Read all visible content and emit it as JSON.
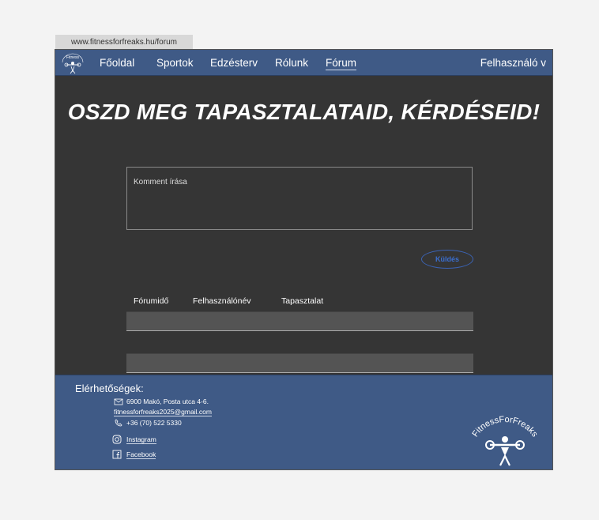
{
  "browser": {
    "url": "www.fitnessforfreaks.hu/forum"
  },
  "nav": {
    "items": [
      {
        "label": "Főoldal"
      },
      {
        "label": "Sportok"
      },
      {
        "label": "Edzésterv"
      },
      {
        "label": "Rólunk"
      },
      {
        "label": "Fórum"
      }
    ],
    "active": "Fórum",
    "user_menu": "Felhasználó v"
  },
  "hero": {
    "title": "OSZD MEG TAPASZTALATAID, KÉRDÉSEID!"
  },
  "comment": {
    "placeholder": "Komment írása",
    "send_label": "Küldés"
  },
  "table": {
    "columns": [
      "Fórumidő",
      "Felhasználónév",
      "Tapasztalat"
    ]
  },
  "footer": {
    "title": "Elérhetőségek:",
    "address": "6900 Makó, Posta utca 4-6.",
    "email": "fitnessforfreaks2025@gmail.com",
    "phone": "+36 (70) 522 5330",
    "instagram": "Instagram",
    "facebook": "Facebook",
    "logo_text": "FitnessForFreaks"
  },
  "colors": {
    "nav_bg": "#3f5a86",
    "page_bg": "#353535",
    "accent": "#3b6fd0"
  },
  "icons": [
    "logo",
    "mail-icon",
    "email-at-icon",
    "phone-icon",
    "instagram-icon",
    "facebook-icon"
  ]
}
